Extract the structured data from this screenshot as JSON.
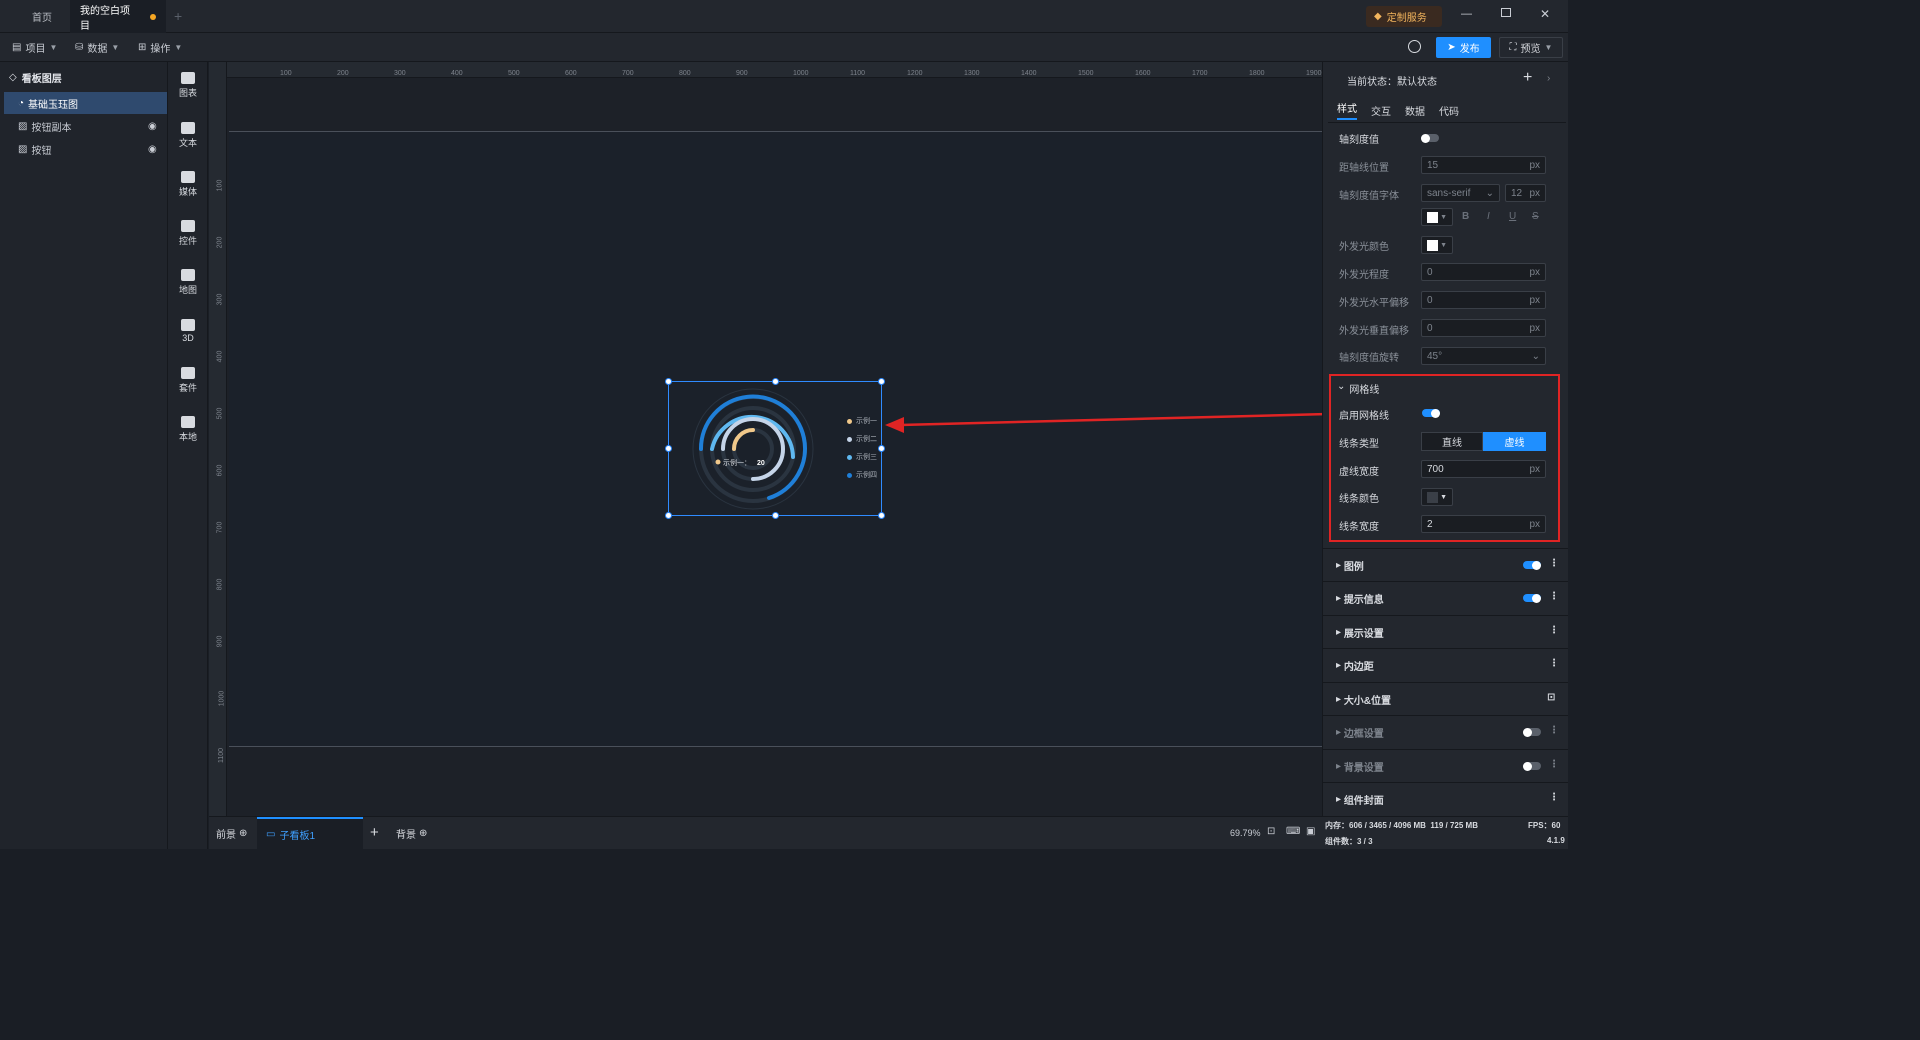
{
  "tabs": [
    {
      "label": "首页"
    },
    {
      "label": "我的空白项目"
    }
  ],
  "window": {
    "service_label": "定制服务"
  },
  "menu": {
    "project": "项目",
    "data": "数据",
    "operate": "操作",
    "publish": "发布",
    "preview": "预览"
  },
  "layers": {
    "title": "看板图层",
    "items": [
      {
        "label": "基础玉珏图"
      },
      {
        "label": "按钮副本"
      },
      {
        "label": "按钮"
      }
    ]
  },
  "toolbox": [
    {
      "label": "图表"
    },
    {
      "label": "文本"
    },
    {
      "label": "媒体"
    },
    {
      "label": "控件"
    },
    {
      "label": "地图"
    },
    {
      "label": "3D"
    },
    {
      "label": "套件"
    },
    {
      "label": "本地"
    }
  ],
  "ruler": {
    "top": [
      "100",
      "200",
      "300",
      "400",
      "500",
      "600",
      "700",
      "800",
      "900",
      "1000",
      "1100",
      "1200",
      "1300",
      "1400",
      "1500",
      "1600",
      "1700",
      "1800",
      "1900"
    ],
    "left": [
      "100",
      "200",
      "300",
      "400",
      "500",
      "600",
      "700",
      "800",
      "900",
      "1000",
      "1100"
    ]
  },
  "chart": {
    "center_label": "示例一：",
    "center_value": "20",
    "legend": [
      "示例一",
      "示例二",
      "示例三",
      "示例四"
    ],
    "legend_colors": [
      "#f0c88a",
      "#c5d4e8",
      "#5fb8f0",
      "#1f7fd8"
    ]
  },
  "bottom": {
    "foreground": "前景",
    "subboard": "子看板1",
    "background": "背景",
    "zoom": "69.79%"
  },
  "panel": {
    "state_label": "当前状态：默认状态",
    "tabs": [
      "样式",
      "交互",
      "数据",
      "代码"
    ],
    "props": {
      "axis_tick_value": "轴刻度值",
      "distance_label": "距轴线位置",
      "distance_value": "15",
      "font_label": "轴刻度值字体",
      "font_value": "sans-serif",
      "font_size": "12",
      "glow_color_label": "外发光颜色",
      "glow_level_label": "外发光程度",
      "glow_level_value": "0",
      "glow_h_label": "外发光水平偏移",
      "glow_h_value": "0",
      "glow_v_label": "外发光垂直偏移",
      "glow_v_value": "0",
      "rotate_label": "轴刻度值旋转",
      "rotate_value": "45°",
      "unit": "px"
    },
    "grid": {
      "title": "网格线",
      "enable_label": "启用网格线",
      "line_type_label": "线条类型",
      "line_type_options": [
        "直线",
        "虚线"
      ],
      "dash_width_label": "虚线宽度",
      "dash_width_value": "700",
      "line_color_label": "线条颜色",
      "line_width_label": "线条宽度",
      "line_width_value": "2"
    },
    "sections": [
      {
        "label": "图例"
      },
      {
        "label": "提示信息"
      },
      {
        "label": "展示设置"
      },
      {
        "label": "内边距"
      },
      {
        "label": "大小&位置"
      },
      {
        "label": "边框设置"
      },
      {
        "label": "背景设置"
      },
      {
        "label": "组件封面"
      }
    ]
  },
  "status": {
    "memory": "内存：606 / 3465 / 4096 MB  119 / 725 MB",
    "fps": "FPS：60",
    "components": "组件数：3 / 3",
    "version": "4.1.9"
  },
  "colors": {
    "accent": "#1f8fff",
    "highlight": "#e02424"
  }
}
